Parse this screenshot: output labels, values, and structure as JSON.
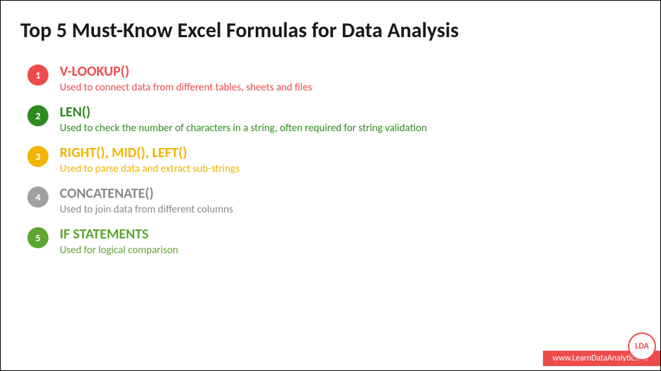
{
  "title": "Top 5 Must-Know Excel Formulas for Data Analysis",
  "items": [
    {
      "num": "1",
      "heading": "V-LOOKUP()",
      "desc": "Used to connect data from different tables, sheets and files",
      "color": "red"
    },
    {
      "num": "2",
      "heading": "LEN()",
      "desc": "Used to check the number of characters in a string, often required for string validation",
      "color": "green"
    },
    {
      "num": "3",
      "heading": "RIGHT(), MID(), LEFT()",
      "desc": "Used to parse data and extract sub-strings",
      "color": "amber"
    },
    {
      "num": "4",
      "heading": "CONCATENATE()",
      "desc": "Used to join data from different columns",
      "color": "gray"
    },
    {
      "num": "5",
      "heading": "IF STATEMENTS",
      "desc": "Used for logical comparison",
      "color": "green2"
    }
  ],
  "footer": {
    "url": "www.LearnDataAnalytics.ca",
    "logo": "LDA"
  }
}
